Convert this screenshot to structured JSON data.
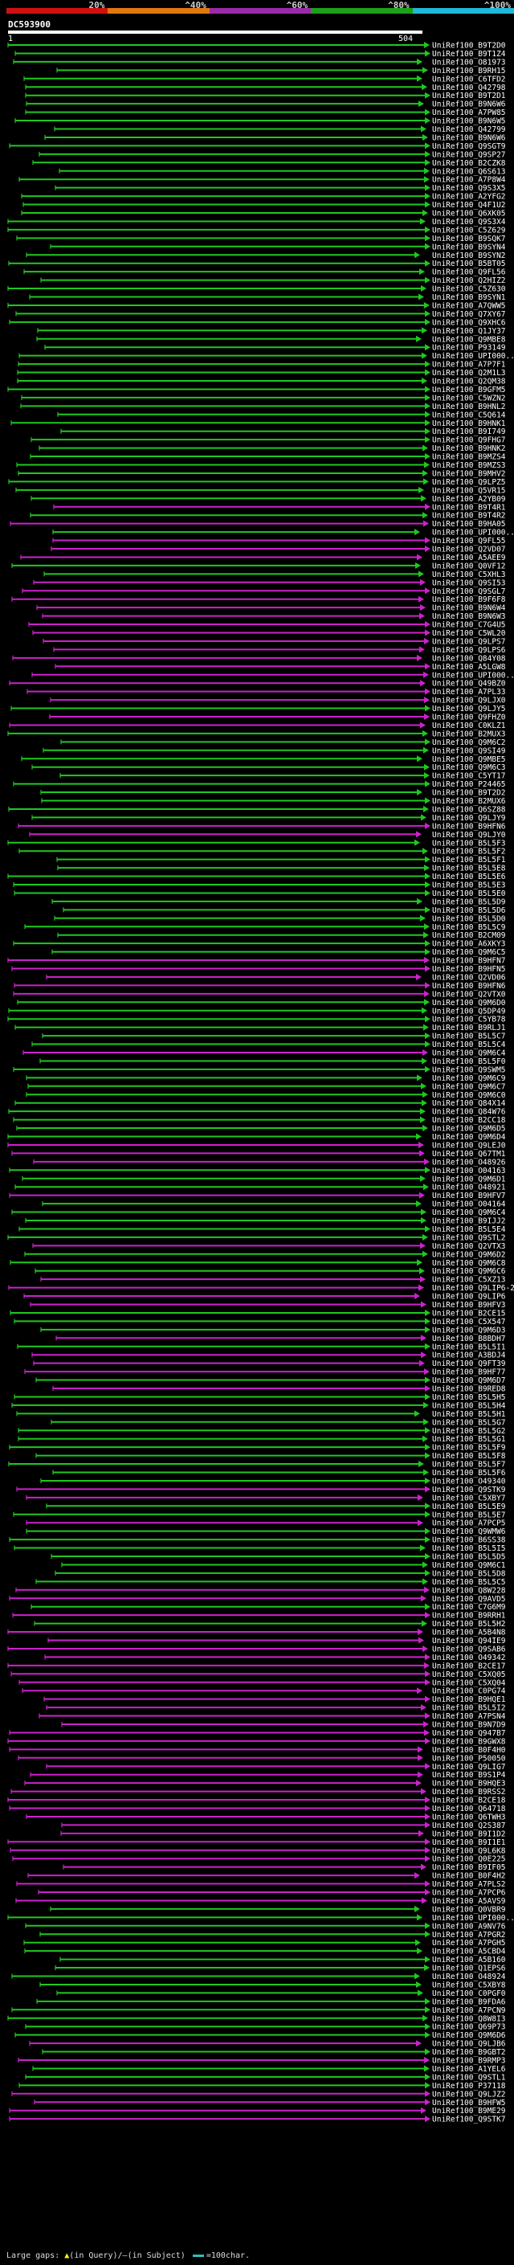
{
  "scale": {
    "ticks": [
      "20%",
      "^40%",
      "^60%",
      "^80%",
      "^100%"
    ],
    "colors": [
      "#d01010",
      "#e07810",
      "#9a2aa8",
      "#1aa21a",
      "#20b8d8"
    ]
  },
  "query": {
    "title": "DC593900",
    "range_start": "1",
    "range_end": "504"
  },
  "hits": [
    {
      "label": "UniRef100_B9T2D0",
      "color": "green"
    },
    {
      "label": "UniRef100_B9T1Z4",
      "color": "green"
    },
    {
      "label": "UniRef100_O81973",
      "color": "green"
    },
    {
      "label": "UniRef100_B9RH15",
      "color": "green"
    },
    {
      "label": "UniRef100_C6TFD2",
      "color": "green"
    },
    {
      "label": "UniRef100_Q42798",
      "color": "green"
    },
    {
      "label": "UniRef100_B9T2D1",
      "color": "green"
    },
    {
      "label": "UniRef100_B9N6W6",
      "color": "green"
    },
    {
      "label": "UniRef100_A7PW85",
      "color": "green"
    },
    {
      "label": "UniRef100_B9N6W5",
      "color": "green"
    },
    {
      "label": "UniRef100_Q42799",
      "color": "green"
    },
    {
      "label": "UniRef100_B9N6W6",
      "color": "green"
    },
    {
      "label": "UniRef100_Q9SGT9",
      "color": "green"
    },
    {
      "label": "UniRef100_Q9SP27",
      "color": "green"
    },
    {
      "label": "UniRef100_B2CZK8",
      "color": "green"
    },
    {
      "label": "UniRef100_Q6S613",
      "color": "green"
    },
    {
      "label": "UniRef100_A7P8W4",
      "color": "green"
    },
    {
      "label": "UniRef100_Q9S3X5",
      "color": "green"
    },
    {
      "label": "UniRef100_A2YFG2",
      "color": "green"
    },
    {
      "label": "UniRef100_Q4F1U2",
      "color": "green"
    },
    {
      "label": "UniRef100_Q6XK05",
      "color": "green"
    },
    {
      "label": "UniRef100_Q9S3X4",
      "color": "green"
    },
    {
      "label": "UniRef100_C5Z629",
      "color": "green"
    },
    {
      "label": "UniRef100_B9SQK7",
      "color": "green"
    },
    {
      "label": "UniRef100_B9SYN4",
      "color": "green"
    },
    {
      "label": "UniRef100_B9SYN2",
      "color": "green"
    },
    {
      "label": "UniRef100_B5BT05",
      "color": "green"
    },
    {
      "label": "UniRef100_Q9FL56",
      "color": "green"
    },
    {
      "label": "UniRef100_Q2HIZ2",
      "color": "green"
    },
    {
      "label": "UniRef100_C5Z630",
      "color": "green"
    },
    {
      "label": "UniRef100_B9SYN1",
      "color": "green"
    },
    {
      "label": "UniRef100_A7QWW5",
      "color": "green"
    },
    {
      "label": "UniRef100_Q7XY67",
      "color": "green"
    },
    {
      "label": "UniRef100_Q9XHC6",
      "color": "green"
    },
    {
      "label": "UniRef100_Q1JY37",
      "color": "green"
    },
    {
      "label": "UniRef100_Q9MBE8",
      "color": "green"
    },
    {
      "label": "UniRef100_P93149",
      "color": "green"
    },
    {
      "label": "UniRef100_UPI000...",
      "color": "green"
    },
    {
      "label": "UniRef100_A7P7F1",
      "color": "green"
    },
    {
      "label": "UniRef100_Q2M1L3",
      "color": "green"
    },
    {
      "label": "UniRef100_Q2QM38",
      "color": "green"
    },
    {
      "label": "UniRef100_B9GFM5",
      "color": "green"
    },
    {
      "label": "UniRef100_C5WZN2",
      "color": "green"
    },
    {
      "label": "UniRef100_B9HNL2",
      "color": "green"
    },
    {
      "label": "UniRef100_C5Q614",
      "color": "green"
    },
    {
      "label": "UniRef100_B9HNK1",
      "color": "green"
    },
    {
      "label": "UniRef100_B9I749",
      "color": "green"
    },
    {
      "label": "UniRef100_Q9FHG7",
      "color": "green"
    },
    {
      "label": "UniRef100_B9HNK2",
      "color": "green"
    },
    {
      "label": "UniRef100_B9MZS4",
      "color": "green"
    },
    {
      "label": "UniRef100_B9MZS3",
      "color": "green"
    },
    {
      "label": "UniRef100_B9MHV2",
      "color": "green"
    },
    {
      "label": "UniRef100_Q9LPZ5",
      "color": "green"
    },
    {
      "label": "UniRef100_Q5VR15",
      "color": "green"
    },
    {
      "label": "UniRef100_A2YB09",
      "color": "green"
    },
    {
      "label": "UniRef100_B9T4R1",
      "color": "magenta"
    },
    {
      "label": "UniRef100_B9T4R2",
      "color": "green"
    },
    {
      "label": "UniRef100_B9HA05",
      "color": "magenta"
    },
    {
      "label": "UniRef100_UPI000...",
      "color": "green"
    },
    {
      "label": "UniRef100_Q9FL55",
      "color": "magenta"
    },
    {
      "label": "UniRef100_Q2VD07",
      "color": "magenta"
    },
    {
      "label": "UniRef100_A5AEE9",
      "color": "magenta"
    },
    {
      "label": "UniRef100_Q0VF12",
      "color": "green"
    },
    {
      "label": "UniRef100_C5XHL3",
      "color": "green"
    },
    {
      "label": "UniRef100_Q9SI53",
      "color": "magenta"
    },
    {
      "label": "UniRef100_Q9SGL7",
      "color": "magenta"
    },
    {
      "label": "UniRef100_B9F6F8",
      "color": "magenta"
    },
    {
      "label": "UniRef100_B9N6W4",
      "color": "magenta"
    },
    {
      "label": "UniRef100_B9N6W3",
      "color": "magenta"
    },
    {
      "label": "UniRef100_C7G4U5",
      "color": "magenta"
    },
    {
      "label": "UniRef100_C5WL20",
      "color": "magenta"
    },
    {
      "label": "UniRef100_Q9LPS7",
      "color": "magenta"
    },
    {
      "label": "UniRef100_Q9LPS6",
      "color": "magenta"
    },
    {
      "label": "UniRef100_Q84Y08",
      "color": "magenta"
    },
    {
      "label": "UniRef100_A5LGW8",
      "color": "magenta"
    },
    {
      "label": "UniRef100_UPI000...",
      "color": "magenta"
    },
    {
      "label": "UniRef100_Q49BZ0",
      "color": "magenta"
    },
    {
      "label": "UniRef100_A7PL33",
      "color": "magenta"
    },
    {
      "label": "UniRef100_Q9LJX0",
      "color": "magenta"
    },
    {
      "label": "UniRef100_Q9LJY5",
      "color": "green"
    },
    {
      "label": "UniRef100_Q9FHZ0",
      "color": "magenta"
    },
    {
      "label": "UniRef100_C0KLZ1",
      "color": "magenta"
    },
    {
      "label": "UniRef100_B2MUX3",
      "color": "green"
    },
    {
      "label": "UniRef100_Q9M6C2",
      "color": "green"
    },
    {
      "label": "UniRef100_Q9SI49",
      "color": "green"
    },
    {
      "label": "UniRef100_Q9MBE5",
      "color": "green"
    },
    {
      "label": "UniRef100_Q9M6C3",
      "color": "green"
    },
    {
      "label": "UniRef100_C5YT17",
      "color": "green"
    },
    {
      "label": "UniRef100_P24465",
      "color": "green"
    },
    {
      "label": "UniRef100_B9T2D2",
      "color": "green"
    },
    {
      "label": "UniRef100_B2MUX6",
      "color": "green"
    },
    {
      "label": "UniRef100_Q6SZ88",
      "color": "green"
    },
    {
      "label": "UniRef100_Q9LJY9",
      "color": "green"
    },
    {
      "label": "UniRef100_B9HFN6",
      "color": "magenta"
    },
    {
      "label": "UniRef100_Q9LJY0",
      "color": "magenta"
    },
    {
      "label": "UniRef100_B5L5F3",
      "color": "green"
    },
    {
      "label": "UniRef100_B5L5F2",
      "color": "green"
    },
    {
      "label": "UniRef100_B5L5F1",
      "color": "green"
    },
    {
      "label": "UniRef100_B5L5E8",
      "color": "green"
    },
    {
      "label": "UniRef100_B5L5E6",
      "color": "green"
    },
    {
      "label": "UniRef100_B5L5E3",
      "color": "green"
    },
    {
      "label": "UniRef100_B5L5E0",
      "color": "green"
    },
    {
      "label": "UniRef100_B5L5D9",
      "color": "green"
    },
    {
      "label": "UniRef100_B5L5D6",
      "color": "green"
    },
    {
      "label": "UniRef100_B5L5D0",
      "color": "green"
    },
    {
      "label": "UniRef100_B5L5C9",
      "color": "green"
    },
    {
      "label": "UniRef100_B2CM09",
      "color": "green"
    },
    {
      "label": "UniRef100_A6XKY3",
      "color": "green"
    },
    {
      "label": "UniRef100_Q9M6C5",
      "color": "green"
    },
    {
      "label": "UniRef100_B9HFN7",
      "color": "magenta"
    },
    {
      "label": "UniRef100_B9HFN5",
      "color": "magenta"
    },
    {
      "label": "UniRef100_Q2VD06",
      "color": "magenta"
    },
    {
      "label": "UniRef100_B9HFN6",
      "color": "magenta"
    },
    {
      "label": "UniRef100_Q2VTX0",
      "color": "magenta"
    },
    {
      "label": "UniRef100_Q9M6D0",
      "color": "green"
    },
    {
      "label": "UniRef100_Q5DP49",
      "color": "green"
    },
    {
      "label": "UniRef100_C5YB78",
      "color": "green"
    },
    {
      "label": "UniRef100_B9RLJ1",
      "color": "green"
    },
    {
      "label": "UniRef100_B5L5C7",
      "color": "green"
    },
    {
      "label": "UniRef100_B5L5C4",
      "color": "green"
    },
    {
      "label": "UniRef100_Q9M6C4",
      "color": "magenta"
    },
    {
      "label": "UniRef100_B5L5F0",
      "color": "green"
    },
    {
      "label": "UniRef100_Q9SWM5",
      "color": "green"
    },
    {
      "label": "UniRef100_Q9M6C9",
      "color": "green"
    },
    {
      "label": "UniRef100_Q9M6C7",
      "color": "green"
    },
    {
      "label": "UniRef100_Q9M6C0",
      "color": "green"
    },
    {
      "label": "UniRef100_Q84X14",
      "color": "green"
    },
    {
      "label": "UniRef100_Q84W76",
      "color": "green"
    },
    {
      "label": "UniRef100_B2CC18",
      "color": "green"
    },
    {
      "label": "UniRef100_Q9M6D5",
      "color": "green"
    },
    {
      "label": "UniRef100_Q9M6D4",
      "color": "green"
    },
    {
      "label": "UniRef100_Q9LEJ0",
      "color": "magenta"
    },
    {
      "label": "UniRef100_Q67TM1",
      "color": "magenta"
    },
    {
      "label": "UniRef100_O48926",
      "color": "magenta"
    },
    {
      "label": "UniRef100_O04163",
      "color": "green"
    },
    {
      "label": "UniRef100_Q9M6D1",
      "color": "green"
    },
    {
      "label": "UniRef100_O48921",
      "color": "green"
    },
    {
      "label": "UniRef100_B9HFV7",
      "color": "magenta"
    },
    {
      "label": "UniRef100_O04164",
      "color": "green"
    },
    {
      "label": "UniRef100_Q9M6C4",
      "color": "green"
    },
    {
      "label": "UniRef100_B9IJJ2",
      "color": "green"
    },
    {
      "label": "UniRef100_B5L5E4",
      "color": "green"
    },
    {
      "label": "UniRef100_Q9STL2",
      "color": "green"
    },
    {
      "label": "UniRef100_Q2VTX3",
      "color": "magenta"
    },
    {
      "label": "UniRef100_Q9M6D2",
      "color": "green"
    },
    {
      "label": "UniRef100_Q9M6C8",
      "color": "green"
    },
    {
      "label": "UniRef100_Q9M6C6",
      "color": "green"
    },
    {
      "label": "UniRef100_C5XZ13",
      "color": "magenta"
    },
    {
      "label": "UniRef100_Q9LIP6-2",
      "color": "magenta"
    },
    {
      "label": "UniRef100_Q9LIP6",
      "color": "magenta"
    },
    {
      "label": "UniRef100_B9HFV3",
      "color": "magenta"
    },
    {
      "label": "UniRef100_B2CE15",
      "color": "green"
    },
    {
      "label": "UniRef100_C5X547",
      "color": "green"
    },
    {
      "label": "UniRef100_Q9M6D3",
      "color": "green"
    },
    {
      "label": "UniRef100_B8BDH7",
      "color": "magenta"
    },
    {
      "label": "UniRef100_B5L5I1",
      "color": "green"
    },
    {
      "label": "UniRef100_A3BDJ4",
      "color": "magenta"
    },
    {
      "label": "UniRef100_Q9FT39",
      "color": "magenta"
    },
    {
      "label": "UniRef100_B9HF77",
      "color": "magenta"
    },
    {
      "label": "UniRef100_Q9M6D7",
      "color": "green"
    },
    {
      "label": "UniRef100_B9RED8",
      "color": "magenta"
    },
    {
      "label": "UniRef100_B5L5H5",
      "color": "green"
    },
    {
      "label": "UniRef100_B5L5H4",
      "color": "green"
    },
    {
      "label": "UniRef100_B5L5H1",
      "color": "green"
    },
    {
      "label": "UniRef100_B5L5G7",
      "color": "green"
    },
    {
      "label": "UniRef100_B5L5G2",
      "color": "green"
    },
    {
      "label": "UniRef100_B5L5G1",
      "color": "green"
    },
    {
      "label": "UniRef100_B5L5F9",
      "color": "green"
    },
    {
      "label": "UniRef100_B5L5F8",
      "color": "green"
    },
    {
      "label": "UniRef100_B5L5F7",
      "color": "green"
    },
    {
      "label": "UniRef100_B5L5F6",
      "color": "green"
    },
    {
      "label": "UniRef100_O49340",
      "color": "green"
    },
    {
      "label": "UniRef100_Q9STK9",
      "color": "magenta"
    },
    {
      "label": "UniRef100_C5XBY7",
      "color": "magenta"
    },
    {
      "label": "UniRef100_B5L5E9",
      "color": "green"
    },
    {
      "label": "UniRef100_B5L5E7",
      "color": "green"
    },
    {
      "label": "UniRef100_A7PCP5",
      "color": "magenta"
    },
    {
      "label": "UniRef100_Q9WMW6",
      "color": "green"
    },
    {
      "label": "UniRef100_B6SS38",
      "color": "green"
    },
    {
      "label": "UniRef100_B5L5I5",
      "color": "green"
    },
    {
      "label": "UniRef100_B5L5D5",
      "color": "green"
    },
    {
      "label": "UniRef100_Q9M6C1",
      "color": "green"
    },
    {
      "label": "UniRef100_B5L5D8",
      "color": "green"
    },
    {
      "label": "UniRef100_B5L5C5",
      "color": "green"
    },
    {
      "label": "UniRef100_Q8W228",
      "color": "magenta"
    },
    {
      "label": "UniRef100_Q9AVD5",
      "color": "magenta"
    },
    {
      "label": "UniRef100_C7G6M9",
      "color": "green"
    },
    {
      "label": "UniRef100_B9RRH1",
      "color": "magenta"
    },
    {
      "label": "UniRef100_B5L5H2",
      "color": "green"
    },
    {
      "label": "UniRef100_A5B4N8",
      "color": "magenta"
    },
    {
      "label": "UniRef100_Q94IE9",
      "color": "magenta"
    },
    {
      "label": "UniRef100_Q9SAB6",
      "color": "magenta"
    },
    {
      "label": "UniRef100_O49342",
      "color": "magenta"
    },
    {
      "label": "UniRef100_B2CE17",
      "color": "magenta"
    },
    {
      "label": "UniRef100_C5XQ05",
      "color": "magenta"
    },
    {
      "label": "UniRef100_C5XQ04",
      "color": "magenta"
    },
    {
      "label": "UniRef100_C0PG74",
      "color": "magenta"
    },
    {
      "label": "UniRef100_B9HQE1",
      "color": "magenta"
    },
    {
      "label": "UniRef100_B5L5I2",
      "color": "magenta"
    },
    {
      "label": "UniRef100_A7PSN4",
      "color": "magenta"
    },
    {
      "label": "UniRef100_B9N7D9",
      "color": "magenta"
    },
    {
      "label": "UniRef100_Q947B7",
      "color": "magenta"
    },
    {
      "label": "UniRef100_B9GWX8",
      "color": "magenta"
    },
    {
      "label": "UniRef100_B0F4H0",
      "color": "magenta"
    },
    {
      "label": "UniRef100_P50050",
      "color": "magenta"
    },
    {
      "label": "UniRef100_Q9LIG7",
      "color": "magenta"
    },
    {
      "label": "UniRef100_B9S1P4",
      "color": "magenta"
    },
    {
      "label": "UniRef100_B9HQE3",
      "color": "magenta"
    },
    {
      "label": "UniRef100_B9RSS2",
      "color": "magenta"
    },
    {
      "label": "UniRef100_B2CE18",
      "color": "magenta"
    },
    {
      "label": "UniRef100_Q64718",
      "color": "magenta"
    },
    {
      "label": "UniRef100_Q6TWH3",
      "color": "magenta"
    },
    {
      "label": "UniRef100_Q2S387",
      "color": "magenta"
    },
    {
      "label": "UniRef100_B9I1D2",
      "color": "magenta"
    },
    {
      "label": "UniRef100_B9I1E1",
      "color": "magenta"
    },
    {
      "label": "UniRef100_Q9L6K8",
      "color": "magenta"
    },
    {
      "label": "UniRef100_Q0E225",
      "color": "magenta"
    },
    {
      "label": "UniRef100_B9IF05",
      "color": "magenta"
    },
    {
      "label": "UniRef100_B0F4H2",
      "color": "magenta"
    },
    {
      "label": "UniRef100_A7PLS2",
      "color": "magenta"
    },
    {
      "label": "UniRef100_A7PCP6",
      "color": "magenta"
    },
    {
      "label": "UniRef100_A5AVS9",
      "color": "magenta"
    },
    {
      "label": "UniRef100_Q0VBR9",
      "color": "green"
    },
    {
      "label": "UniRef100_UPI000...",
      "color": "green"
    },
    {
      "label": "UniRef100_A9NV76",
      "color": "green"
    },
    {
      "label": "UniRef100_A7PGR2",
      "color": "green"
    },
    {
      "label": "UniRef100_A7PGH5",
      "color": "green"
    },
    {
      "label": "UniRef100_A5CBD4",
      "color": "green"
    },
    {
      "label": "UniRef100_A5B160",
      "color": "green"
    },
    {
      "label": "UniRef100_Q1EPS6",
      "color": "green"
    },
    {
      "label": "UniRef100_O48924",
      "color": "green"
    },
    {
      "label": "UniRef100_C5XBY8",
      "color": "green"
    },
    {
      "label": "UniRef100_C0PGF0",
      "color": "green"
    },
    {
      "label": "UniRef100_B9FDA6",
      "color": "green"
    },
    {
      "label": "UniRef100_A7PCN9",
      "color": "green"
    },
    {
      "label": "UniRef100_Q8W8I3",
      "color": "green"
    },
    {
      "label": "UniRef100_Q69P73",
      "color": "green"
    },
    {
      "label": "UniRef100_Q9M6D6",
      "color": "green"
    },
    {
      "label": "UniRef100_Q9LJB6",
      "color": "magenta"
    },
    {
      "label": "UniRef100_B9GBT2",
      "color": "green"
    },
    {
      "label": "UniRef100_B9RMP3",
      "color": "magenta"
    },
    {
      "label": "UniRef100_A1YEL6",
      "color": "green"
    },
    {
      "label": "UniRef100_Q9STL1",
      "color": "green"
    },
    {
      "label": "UniRef100_P37118",
      "color": "green"
    },
    {
      "label": "UniRef100_Q9LJZ2",
      "color": "magenta"
    },
    {
      "label": "UniRef100_B9HFW5",
      "color": "magenta"
    },
    {
      "label": "UniRef100_B9ME29",
      "color": "magenta"
    },
    {
      "label": "UniRef100_Q9STK7",
      "color": "magenta"
    }
  ],
  "legend": {
    "large_gaps": "Large gaps:",
    "in_query": "(in Query)/",
    "in_subject": "(in Subject)",
    "scale_text": "=100char."
  },
  "colors": {
    "green": "#1fc81f",
    "magenta": "#cc22cc",
    "label": "#ffffff",
    "background": "#000000"
  }
}
